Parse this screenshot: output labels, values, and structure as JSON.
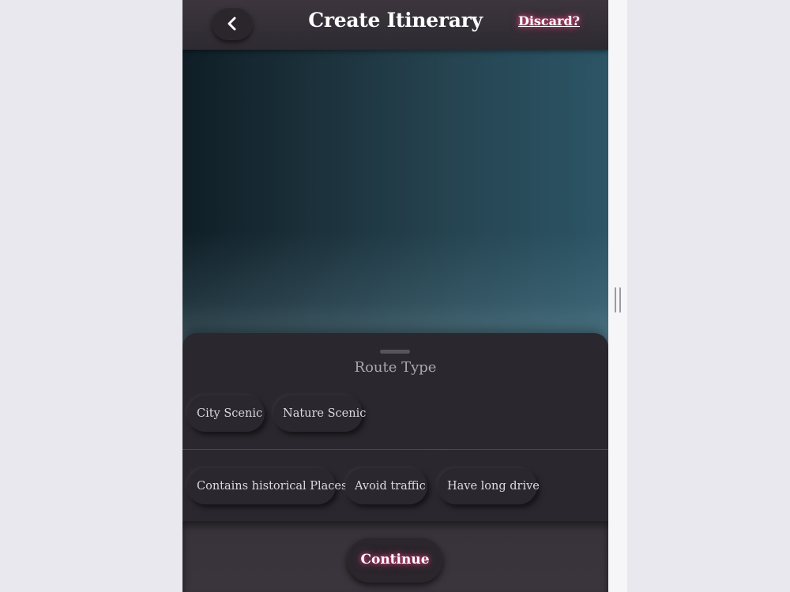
{
  "header": {
    "title": "Create Itinerary",
    "discard_label": "Discard?",
    "back_icon": "chevron-left-icon"
  },
  "sheet": {
    "section_title": "Route Type",
    "route_types": [
      "City Scenic",
      "Nature Scenic"
    ],
    "preferences": [
      "Contains historical Places",
      "Avoid traffic",
      "Have long drive"
    ]
  },
  "footer": {
    "continue_label": "Continue"
  },
  "colors": {
    "accent_glow": "#ff468c",
    "surface": "#2b272e",
    "map_left": "#0f1e26",
    "map_right": "#2c5566"
  }
}
